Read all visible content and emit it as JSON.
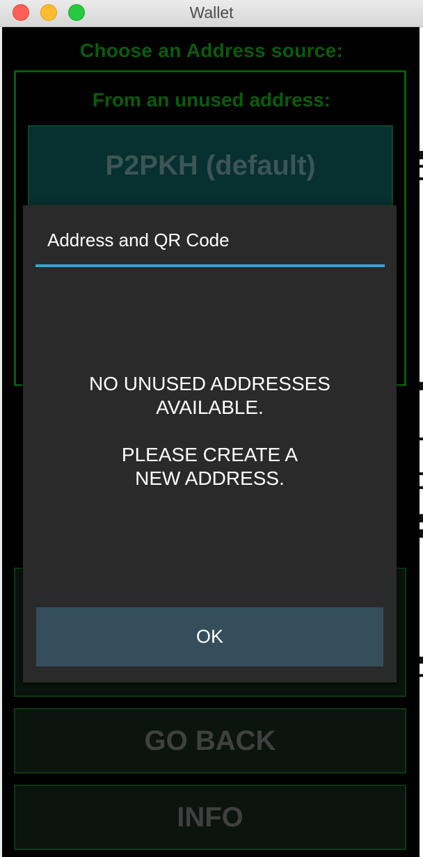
{
  "window": {
    "title": "Wallet"
  },
  "page": {
    "heading": "Choose an Address source:",
    "unused_section": {
      "title": "From an unused address:",
      "p2pkh_button": "P2PKH (default)"
    },
    "go_back_button": "GO BACK",
    "info_button": "INFO"
  },
  "dialog": {
    "title": "Address and QR Code",
    "message_line1": "NO UNUSED ADDRESSES",
    "message_line2": "AVAILABLE.",
    "message_line3": "PLEASE CREATE A",
    "message_line4": "NEW ADDRESS.",
    "ok_button": "OK"
  },
  "colors": {
    "accent_green": "#0a5c0a",
    "dialog_accent": "#33a4d6",
    "dialog_bg": "#2a2a2a",
    "ok_button_bg": "#344f5b"
  }
}
